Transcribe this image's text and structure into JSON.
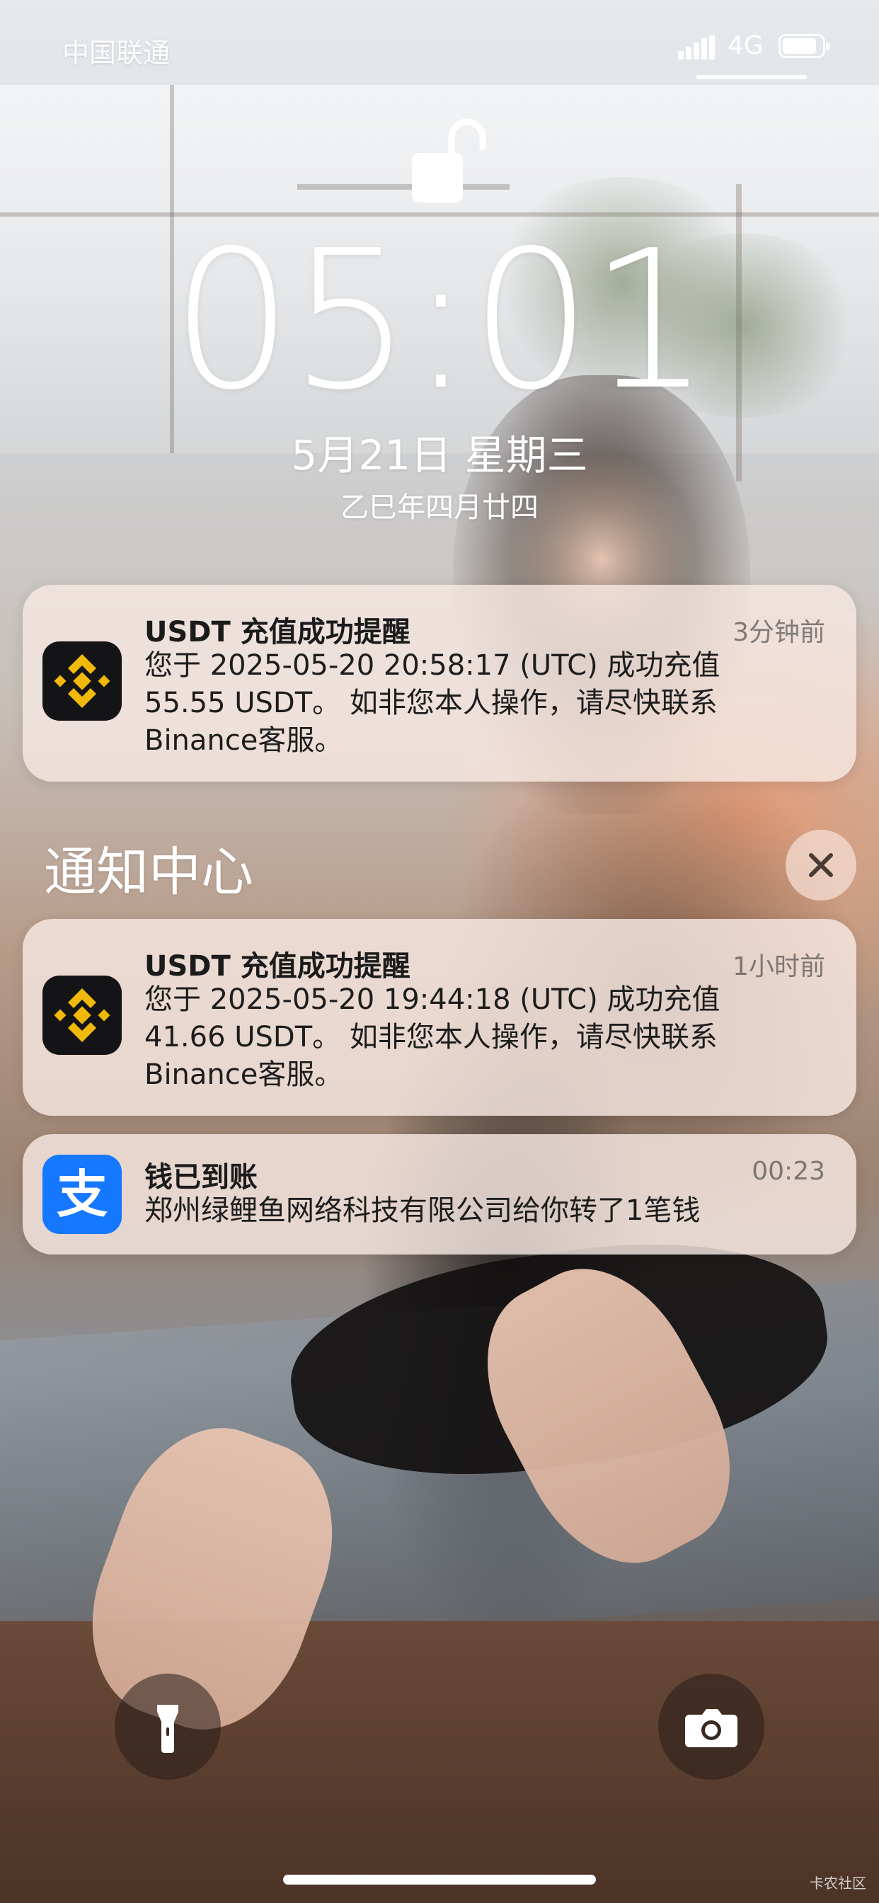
{
  "status_bar": {
    "carrier": "中国联通",
    "network": "4G",
    "icons": [
      "signal-icon",
      "battery-icon"
    ]
  },
  "lock_screen": {
    "lock_icon": "unlocked-padlock-icon",
    "time": "05:01",
    "date": "5月21日 星期三",
    "lunar_date": "乙巳年四月廿四"
  },
  "pinned_notification": {
    "app_icon": "binance-icon",
    "title": "USDT 充值成功提醒",
    "time": "3分钟前",
    "body_lines": [
      "您于 2025-05-20 20:58:17 (UTC) 成功充值",
      "55.55 USDT。 如非您本人操作，请尽快联系",
      "Binance客服。"
    ]
  },
  "notification_center": {
    "title": "通知中心",
    "clear_icon": "close-icon",
    "notifications": [
      {
        "app_icon": "binance-icon",
        "title": "USDT 充值成功提醒",
        "time": "1小时前",
        "body_lines": [
          "您于 2025-05-20 19:44:18 (UTC) 成功充值",
          "41.66 USDT。 如非您本人操作，请尽快联系",
          "Binance客服。"
        ]
      },
      {
        "app_icon": "alipay-icon",
        "icon_glyph": "支",
        "title": "钱已到账",
        "time": "00:23",
        "body_lines": [
          "郑州绿鲤鱼网络科技有限公司给你转了1笔钱"
        ]
      }
    ]
  },
  "bottom_controls": {
    "left": "flashlight-icon",
    "right": "camera-icon"
  },
  "watermark": "卡农社区",
  "colors": {
    "binance_yellow": "#F0B90B",
    "binance_bg": "#141416",
    "alipay_blue": "#1677FF",
    "notification_bg": "#F6E8E2"
  }
}
